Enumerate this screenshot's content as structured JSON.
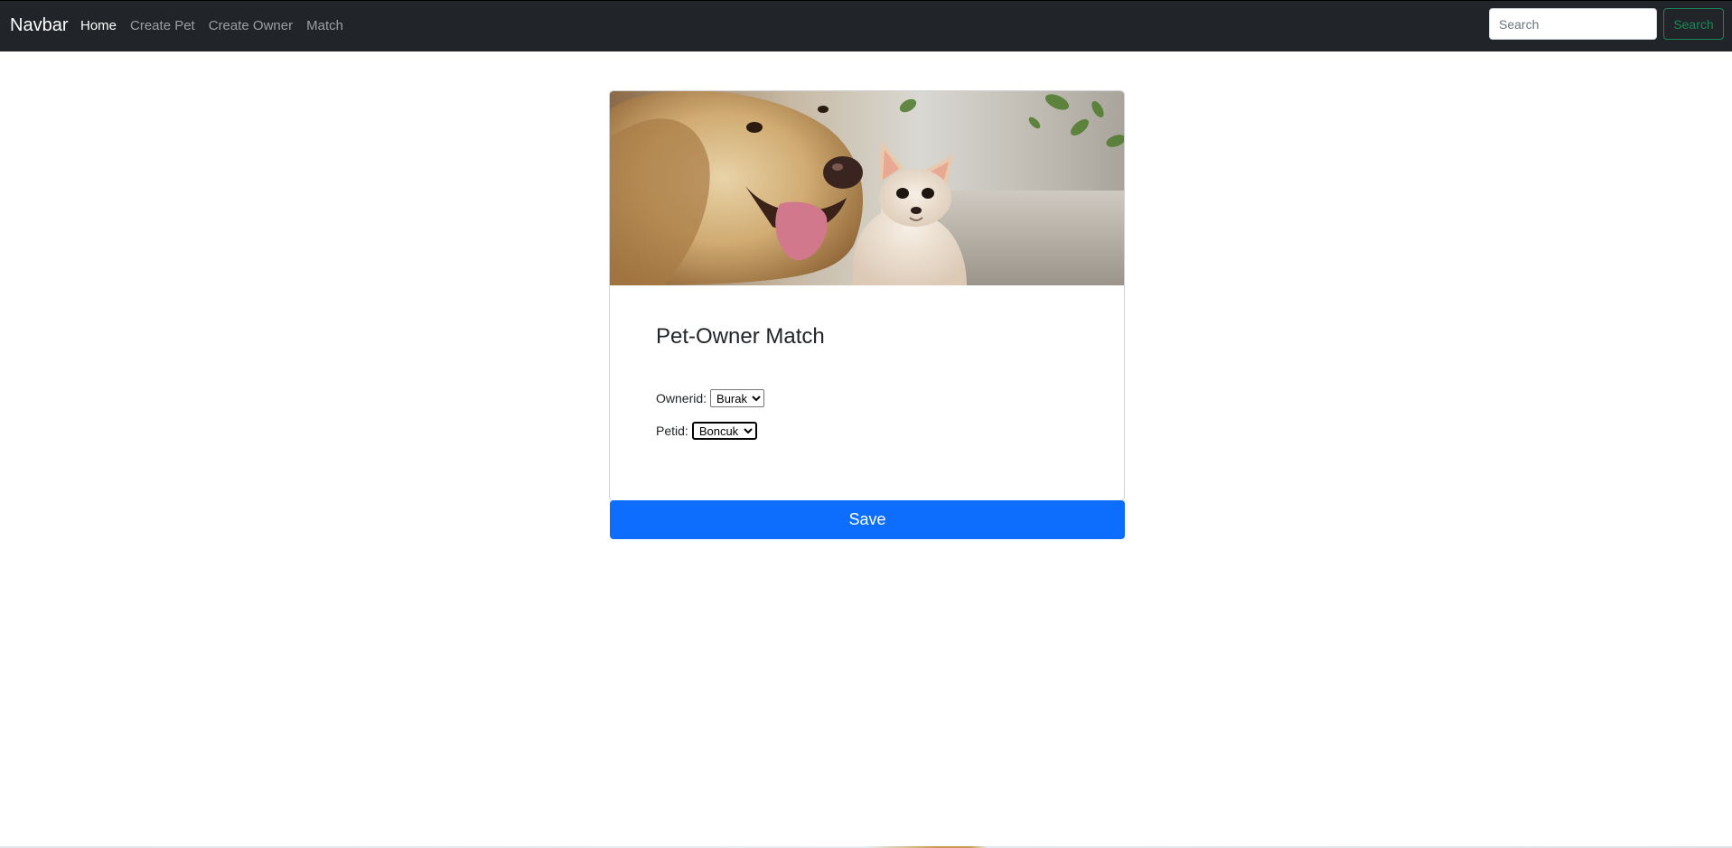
{
  "navbar": {
    "brand": "Navbar",
    "links": [
      {
        "label": "Home",
        "active": true
      },
      {
        "label": "Create Pet",
        "active": false
      },
      {
        "label": "Create Owner",
        "active": false
      },
      {
        "label": "Match",
        "active": false
      }
    ],
    "search": {
      "placeholder": "Search",
      "value": "",
      "button_label": "Search"
    }
  },
  "card": {
    "image_icon": "dog-and-chihuahua-photo",
    "title": "Pet-Owner Match",
    "owner_field": {
      "label": "Ownerid:",
      "selected": "Burak"
    },
    "pet_field": {
      "label": "Petid:",
      "selected": "Boncuk"
    },
    "save_label": "Save"
  },
  "colors": {
    "navbar_bg": "#212529",
    "primary": "#0d6efd",
    "success": "#198754"
  }
}
